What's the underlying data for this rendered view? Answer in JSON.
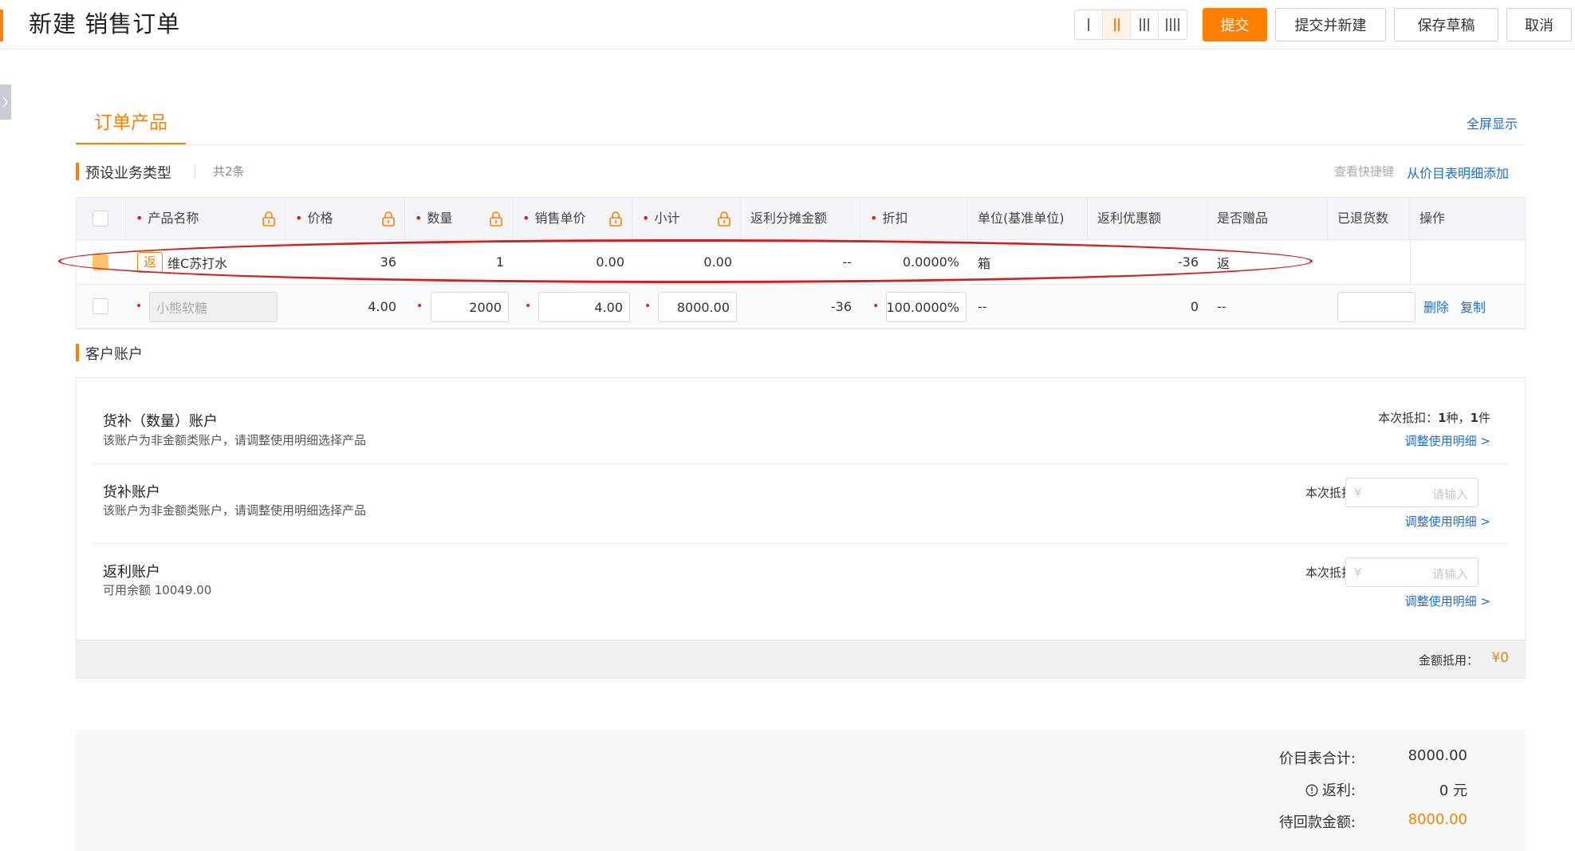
{
  "header": {
    "title": "新建 销售订单",
    "buttons": {
      "submit": "提交",
      "submit_new": "提交并新建",
      "save_draft": "保存草稿",
      "cancel": "取消"
    },
    "column_layouts": [
      "1",
      "2",
      "3",
      "4"
    ],
    "active_layout": "2"
  },
  "tabs": {
    "order_products": "订单产品",
    "fullscreen": "全屏显示"
  },
  "products": {
    "section_title": "预设业务类型",
    "count": "共2条",
    "shortcut_link": "查看快捷键",
    "add_link": "从价目表明细添加",
    "columns": [
      {
        "label": "产品名称",
        "required": true,
        "locked": true
      },
      {
        "label": "价格",
        "required": true,
        "locked": true
      },
      {
        "label": "数量",
        "required": true,
        "locked": true
      },
      {
        "label": "销售单价",
        "required": true,
        "locked": true
      },
      {
        "label": "小计",
        "required": true,
        "locked": true
      },
      {
        "label": "返利分摊金额",
        "required": false,
        "locked": false
      },
      {
        "label": "折扣",
        "required": true,
        "locked": false
      },
      {
        "label": "单位(基准单位)",
        "required": false,
        "locked": false
      },
      {
        "label": "返利优惠额",
        "required": false,
        "locked": false
      },
      {
        "label": "是否赠品",
        "required": false,
        "locked": false
      },
      {
        "label": "已退货数",
        "required": false,
        "locked": false
      },
      {
        "label": "操作",
        "required": false,
        "locked": false
      }
    ],
    "rows": [
      {
        "badge": "返",
        "name": "维C苏打水",
        "price": "36",
        "quantity": "1",
        "unit_price": "0.00",
        "subtotal": "0.00",
        "rebate_allocation": "--",
        "discount": "0.0000%",
        "unit": "箱",
        "rebate_amount": "-36",
        "is_gift": "返",
        "checked": true
      },
      {
        "name_placeholder": "小熊软糖",
        "price": "4.00",
        "quantity": "2000",
        "unit_price": "4.00",
        "subtotal": "8000.00",
        "rebate_allocation": "-36",
        "discount": "100.0000%",
        "unit": "--",
        "rebate_amount": "0",
        "is_gift": "--",
        "returned": "",
        "actions": {
          "delete": "删除",
          "copy": "复制"
        },
        "checked": false
      }
    ]
  },
  "customer_account": {
    "section_title": "客户账户",
    "accounts": [
      {
        "name": "货补（数量）账户",
        "desc": "该账户为非金额类账户，请调整使用明细选择产品",
        "deduct_label": "本次抵扣：",
        "deduct_kinds": "1",
        "deduct_kinds_unit": "种，",
        "deduct_items": "1",
        "deduct_items_unit": "件",
        "link": "调整使用明细 >"
      },
      {
        "name": "货补账户",
        "desc": "该账户为非金额类账户，请调整使用明细选择产品",
        "deduct_label": "本次抵扣",
        "currency": "¥",
        "placeholder": "请输入",
        "link": "调整使用明细 >"
      },
      {
        "name": "返利账户",
        "desc": "可用余额 10049.00",
        "deduct_label": "本次抵扣",
        "currency": "¥",
        "placeholder": "请输入",
        "link": "调整使用明细 >"
      }
    ],
    "footer_label": "金额抵用：",
    "footer_value": "¥0"
  },
  "summary": {
    "price_total_label": "价目表合计:",
    "price_total": "8000.00",
    "rebate_label": "返利:",
    "rebate": "0 元",
    "receivable_label": "待回款金额:",
    "receivable": "8000.00"
  },
  "colors": {
    "accent": "#ff8000",
    "link": "#1a6dd6",
    "annotation": "#d81e1e"
  }
}
